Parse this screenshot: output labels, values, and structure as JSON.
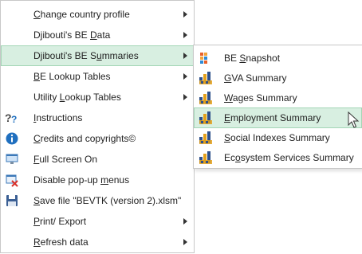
{
  "main_menu": {
    "items": [
      {
        "label_parts": [
          "",
          "C",
          "hange country profile"
        ],
        "has_submenu": true,
        "icon": "",
        "highlighted": false
      },
      {
        "label_parts": [
          "Djibouti's BE ",
          "D",
          "ata"
        ],
        "has_submenu": true,
        "icon": "",
        "highlighted": false
      },
      {
        "label_parts": [
          "Djibouti's BE S",
          "u",
          "mmaries"
        ],
        "has_submenu": true,
        "icon": "",
        "highlighted": true
      },
      {
        "label_parts": [
          "",
          "B",
          "E Lookup Tables"
        ],
        "has_submenu": true,
        "icon": "",
        "highlighted": false
      },
      {
        "label_parts": [
          "Utility ",
          "L",
          "ookup Tables"
        ],
        "has_submenu": true,
        "icon": "",
        "highlighted": false
      },
      {
        "label_parts": [
          "",
          "I",
          "nstructions"
        ],
        "has_submenu": false,
        "icon": "help-icon",
        "highlighted": false
      },
      {
        "label_parts": [
          "",
          "C",
          "redits and copyrights©"
        ],
        "has_submenu": false,
        "icon": "info-icon",
        "highlighted": false
      },
      {
        "label_parts": [
          "",
          "F",
          "ull Screen On"
        ],
        "has_submenu": false,
        "icon": "full-screen-icon",
        "highlighted": false
      },
      {
        "label_parts": [
          "Disable pop-up ",
          "m",
          "enus"
        ],
        "has_submenu": false,
        "icon": "disable-menus-icon",
        "highlighted": false
      },
      {
        "label_parts": [
          "",
          "S",
          "ave file \"BEVTK (version 2).xlsm\""
        ],
        "has_submenu": false,
        "icon": "save-icon",
        "highlighted": false
      },
      {
        "label_parts": [
          "",
          "P",
          "rint/ Export"
        ],
        "has_submenu": true,
        "icon": "",
        "highlighted": false
      },
      {
        "label_parts": [
          "",
          "R",
          "efresh data"
        ],
        "has_submenu": true,
        "icon": "",
        "highlighted": false
      }
    ]
  },
  "submenu": {
    "items": [
      {
        "label_parts": [
          "BE ",
          "S",
          "napshot"
        ],
        "icon": "snapshot-icon",
        "highlighted": false
      },
      {
        "label_parts": [
          "",
          "G",
          "VA Summary"
        ],
        "icon": "summary-chart-icon",
        "highlighted": false
      },
      {
        "label_parts": [
          "",
          "W",
          "ages Summary"
        ],
        "icon": "summary-chart-icon",
        "highlighted": false
      },
      {
        "label_parts": [
          "",
          "E",
          "mployment Summary"
        ],
        "icon": "summary-chart-icon",
        "highlighted": true
      },
      {
        "label_parts": [
          "",
          "S",
          "ocial Indexes Summary"
        ],
        "icon": "summary-chart-icon",
        "highlighted": false
      },
      {
        "label_parts": [
          "Ec",
          "o",
          "system Services Summary"
        ],
        "icon": "summary-chart-icon",
        "highlighted": false
      }
    ]
  },
  "colors": {
    "highlight_bg": "#d8efe1",
    "highlight_border": "#a3d6b6",
    "menu_border": "#c8c8c8"
  }
}
